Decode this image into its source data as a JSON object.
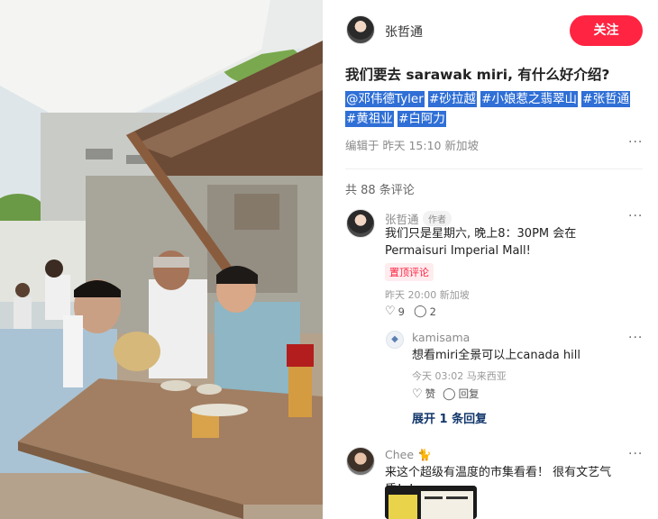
{
  "post": {
    "author": "张哲通",
    "follow_label": "关注",
    "title": "我们要去 sarawak miri, 有什么好介绍?",
    "tags": [
      "@邓伟德Tyler",
      "#砂拉越",
      "#小娘惹之翡翠山",
      "#张哲通",
      "#黄祖业",
      "#白阿力"
    ],
    "edited": "编辑于 昨天 15:10 新加坡",
    "more": "···"
  },
  "comments": {
    "count_label": "共 88 条评论",
    "items": [
      {
        "name": "张哲通",
        "badge": "作者",
        "text": "我们只是星期六, 晚上8：30PM 会在 Permaisuri Imperial Mall!",
        "pinned": "置顶评论",
        "time": "昨天 20:00 新加坡",
        "likes": "9",
        "replies": "2",
        "more": "···"
      },
      {
        "name": "kamisama",
        "text": "想看miri全景可以上canada hill",
        "time": "今天 03:02 马来西亚",
        "like_label": "赞",
        "reply_label": "回复",
        "more": "···"
      },
      {
        "expand_label": "展开 1 条回复"
      },
      {
        "name": "Chee 🐈",
        "text": "来这个超级有温度的市集看看！ 很有文艺气质！！",
        "more": "···"
      }
    ]
  },
  "icons": {
    "heart": "heart-icon",
    "comment": "comment-bubble-icon",
    "kamisama_avatar": "diamond-avatar-icon"
  },
  "colors": {
    "accent": "#ff2442",
    "tag_highlight": "#2f6fd6",
    "link": "#13386c"
  }
}
